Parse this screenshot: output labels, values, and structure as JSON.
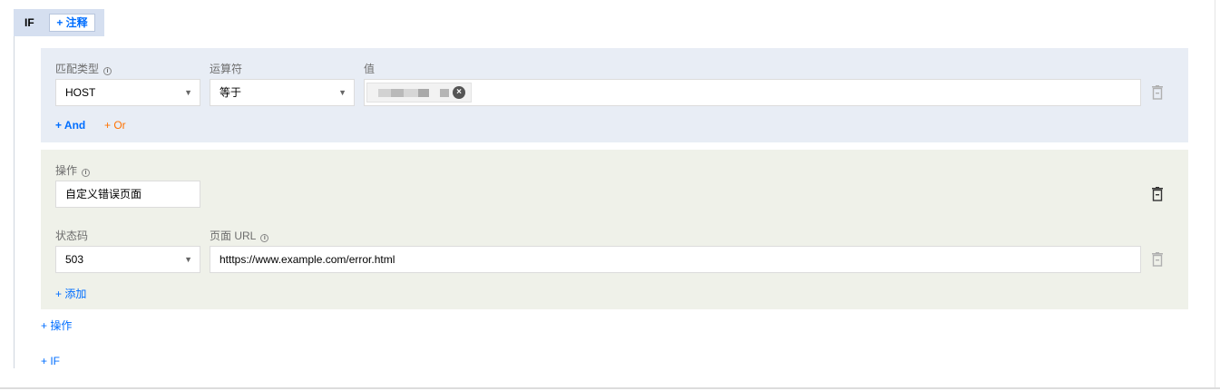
{
  "rule": {
    "if_label": "IF",
    "add_note": "+ 注释"
  },
  "condition": {
    "match_type_label": "匹配类型",
    "operator_label": "运算符",
    "value_label": "值",
    "match_type_value": "HOST",
    "operator_value": "等于",
    "add_and": "+ And",
    "add_or": "+ Or"
  },
  "operation": {
    "operation_label": "操作",
    "operation_value": "自定义错误页面",
    "status_code_label": "状态码",
    "status_code_value": "503",
    "page_url_label": "页面 URL",
    "page_url_value": "htttps://www.example.com/error.html",
    "add_item": "+ 添加"
  },
  "footer": {
    "add_operation": "+ 操作",
    "add_if": "+ IF"
  },
  "colors": {
    "accent": "#006eff",
    "or_accent": "#ff7200",
    "condition_panel_bg": "#e8edf5",
    "operation_panel_bg": "#eff1e9",
    "header_bg": "#d5dff0"
  },
  "icons": {
    "info": "info-circle-icon",
    "dropdown": "caret-down-icon",
    "delete": "trash-icon",
    "remove_tag": "close-circle-icon"
  }
}
